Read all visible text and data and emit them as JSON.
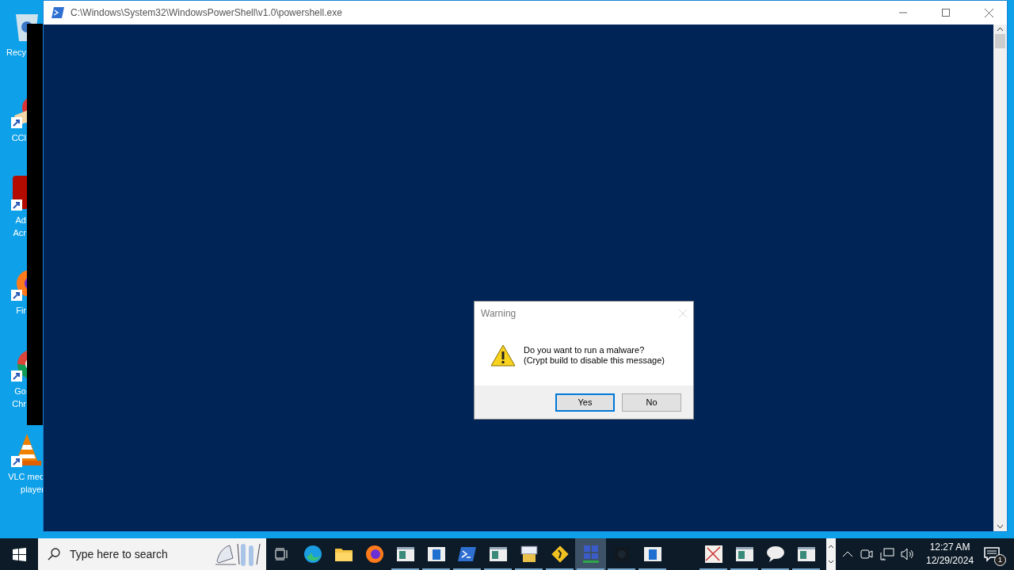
{
  "desktop": {
    "icons": [
      {
        "kind": "recycle",
        "lines": [
          "Recy"
        ]
      },
      {
        "kind": "ccleaner",
        "lines": [
          "CCl"
        ]
      },
      {
        "kind": "acrobat",
        "lines": [
          "Ad",
          "Acr"
        ]
      },
      {
        "kind": "firefox",
        "lines": [
          "Fir"
        ]
      },
      {
        "kind": "chrome",
        "lines": [
          "Go",
          "Chr"
        ]
      },
      {
        "kind": "vlc",
        "lines": [
          "VLC med",
          "player"
        ]
      }
    ]
  },
  "window": {
    "title": "C:\\Windows\\System32\\WindowsPowerShell\\v1.0\\powershell.exe"
  },
  "dialog": {
    "title": "Warning",
    "close_disabled": true,
    "message": [
      "Do you want to run a malware?",
      "(Crypt build to disable this message)"
    ],
    "buttons": [
      {
        "label": "Yes",
        "selected": true
      },
      {
        "label": "No",
        "selected": false
      }
    ]
  },
  "taskbar": {
    "search": {
      "placeholder": "Type here to search"
    },
    "apps": [
      {
        "kind": "edge",
        "running": false,
        "selected": false
      },
      {
        "kind": "folder",
        "running": false,
        "selected": false
      },
      {
        "kind": "firefox",
        "running": false,
        "selected": false
      },
      {
        "kind": "window",
        "running": true,
        "selected": false
      },
      {
        "kind": "bluewindow",
        "running": true,
        "selected": false
      },
      {
        "kind": "powershell",
        "running": true,
        "selected": false
      },
      {
        "kind": "window",
        "running": true,
        "selected": false
      },
      {
        "kind": "installer",
        "running": true,
        "selected": false
      },
      {
        "kind": "diamond",
        "running": true,
        "selected": false
      },
      {
        "kind": "network",
        "running": true,
        "selected": true
      },
      {
        "kind": "dark",
        "running": true,
        "selected": false
      },
      {
        "kind": "bluewindow",
        "running": true,
        "selected": false
      }
    ],
    "apps_right": [
      {
        "kind": "map",
        "running": true,
        "selected": false
      },
      {
        "kind": "window",
        "running": true,
        "selected": false
      },
      {
        "kind": "chat",
        "running": true,
        "selected": false
      },
      {
        "kind": "window",
        "running": true,
        "selected": false
      }
    ],
    "time": "12:27 AM",
    "date": "12/29/2024",
    "notifications": "1"
  }
}
